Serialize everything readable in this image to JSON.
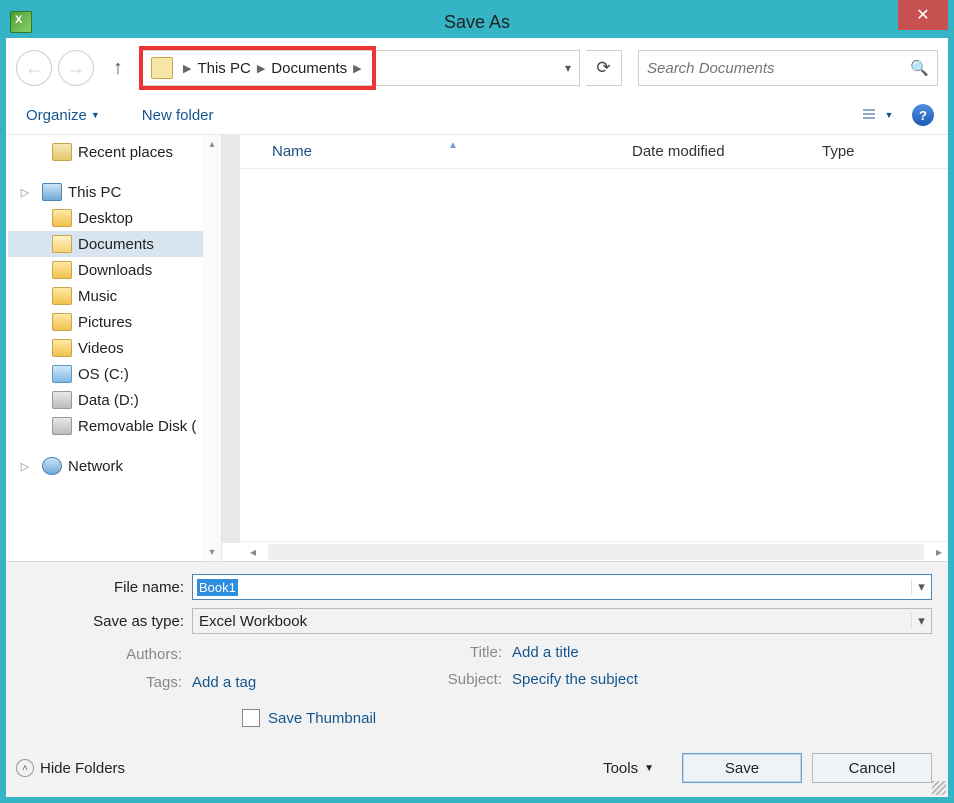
{
  "title": "Save As",
  "breadcrumb": {
    "items": [
      "This PC",
      "Documents"
    ]
  },
  "search": {
    "placeholder": "Search Documents"
  },
  "toolbar": {
    "organize": "Organize",
    "newfolder": "New folder"
  },
  "sidebar": {
    "recent": "Recent places",
    "thispc": "This PC",
    "children": [
      "Desktop",
      "Documents",
      "Downloads",
      "Music",
      "Pictures",
      "Videos",
      "OS (C:)",
      "Data (D:)",
      "Removable Disk ("
    ],
    "network": "Network",
    "selected_index": 1
  },
  "columns": {
    "name": "Name",
    "date": "Date modified",
    "type": "Type"
  },
  "form": {
    "filename_label": "File name:",
    "filename_value": "Book1",
    "savetype_label": "Save as type:",
    "savetype_value": "Excel Workbook",
    "authors_label": "Authors:",
    "tags_label": "Tags:",
    "tags_value": "Add a tag",
    "title_label": "Title:",
    "title_value": "Add a title",
    "subject_label": "Subject:",
    "subject_value": "Specify the subject",
    "save_thumbnail": "Save Thumbnail"
  },
  "footer": {
    "hide_folders": "Hide Folders",
    "tools": "Tools",
    "save": "Save",
    "cancel": "Cancel"
  }
}
